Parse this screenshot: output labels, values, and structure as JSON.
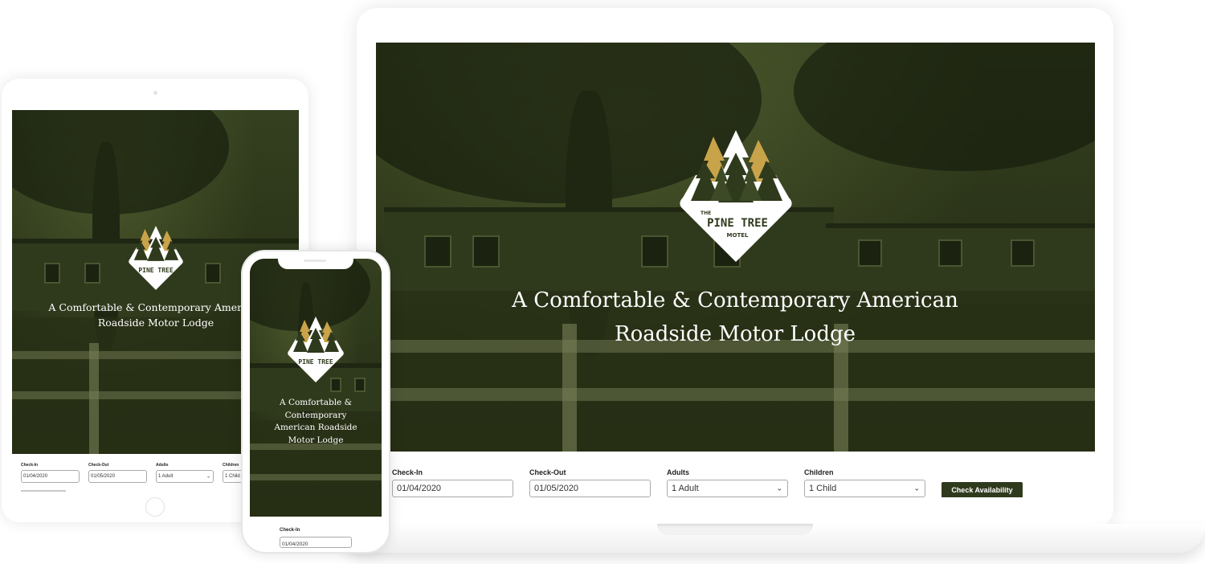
{
  "brand": {
    "logo_the": "THE",
    "logo_name": "PINE TREE",
    "logo_motel": "MOTEL",
    "accent_color": "#2f3a1d",
    "gold_color": "#c9a34a"
  },
  "hero": {
    "tagline_line1": "A Comfortable & Contemporary American",
    "tagline_line2": "Roadside Motor Lodge",
    "tablet_line1": "A Comfortable & Contemporary American",
    "tablet_line2": "Roadside Motor Lodge",
    "phone_line1": "A Comfortable &",
    "phone_line2": "Contemporary",
    "phone_line3": "American Roadside",
    "phone_line4": "Motor Lodge"
  },
  "booking": {
    "checkin_label": "Check-In",
    "checkin_value": "01/04/2020",
    "checkout_label": "Check-Out",
    "checkout_value": "01/05/2020",
    "adults_label": "Adults",
    "adults_value": "1 Adult",
    "children_label": "Children",
    "children_value": "1 Child",
    "button_label": "Check Availability",
    "select_icon": "chevron-down-icon"
  }
}
